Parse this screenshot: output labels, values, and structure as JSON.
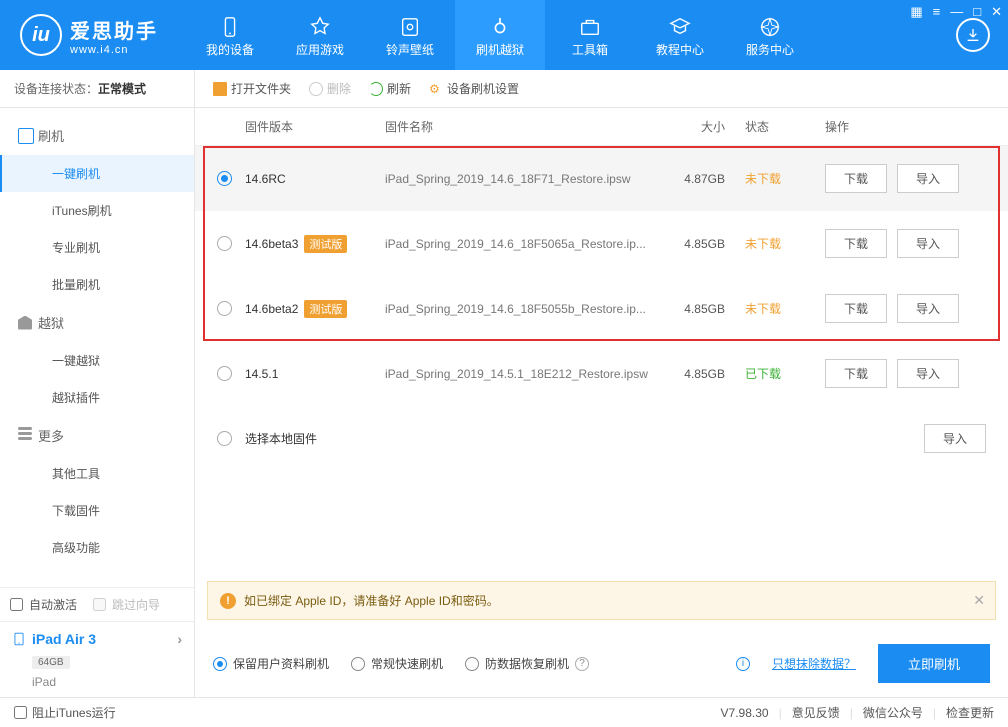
{
  "logo": {
    "title": "爱思助手",
    "sub": "www.i4.cn"
  },
  "nav": {
    "device": "我的设备",
    "apps": "应用游戏",
    "ringtone": "铃声壁纸",
    "flash": "刷机越狱",
    "toolbox": "工具箱",
    "tutorial": "教程中心",
    "service": "服务中心"
  },
  "status": {
    "label": "设备连接状态：",
    "value": "正常模式"
  },
  "sidebar": {
    "flash": "刷机",
    "one_click_flash": "一键刷机",
    "itunes_flash": "iTunes刷机",
    "pro_flash": "专业刷机",
    "batch_flash": "批量刷机",
    "jailbreak": "越狱",
    "one_click_jb": "一键越狱",
    "jb_plugins": "越狱插件",
    "more": "更多",
    "other_tools": "其他工具",
    "download_fw": "下载固件",
    "advanced": "高级功能"
  },
  "toolbar": {
    "open_folder": "打开文件夹",
    "delete": "删除",
    "refresh": "刷新",
    "settings": "设备刷机设置"
  },
  "table_head": {
    "version": "固件版本",
    "name": "固件名称",
    "size": "大小",
    "status": "状态",
    "action": "操作"
  },
  "rows": [
    {
      "version": "14.6RC",
      "tag": "",
      "name": "iPad_Spring_2019_14.6_18F71_Restore.ipsw",
      "size": "4.87GB",
      "status": "未下载",
      "status_class": "orange",
      "selected": true,
      "download": "下载",
      "import": "导入"
    },
    {
      "version": "14.6beta3",
      "tag": "测试版",
      "name": "iPad_Spring_2019_14.6_18F5065a_Restore.ip...",
      "size": "4.85GB",
      "status": "未下载",
      "status_class": "orange",
      "selected": false,
      "download": "下载",
      "import": "导入"
    },
    {
      "version": "14.6beta2",
      "tag": "测试版",
      "name": "iPad_Spring_2019_14.6_18F5055b_Restore.ip...",
      "size": "4.85GB",
      "status": "未下载",
      "status_class": "orange",
      "selected": false,
      "download": "下载",
      "import": "导入"
    },
    {
      "version": "14.5.1",
      "tag": "",
      "name": "iPad_Spring_2019_14.5.1_18E212_Restore.ipsw",
      "size": "4.85GB",
      "status": "已下载",
      "status_class": "green",
      "selected": false,
      "download": "下载",
      "import": "导入"
    }
  ],
  "local_fw": {
    "label": "选择本地固件",
    "import": "导入"
  },
  "auto_activate": "自动激活",
  "skip_guide": "跳过向导",
  "device": {
    "name": "iPad Air 3",
    "storage": "64GB",
    "type": "iPad"
  },
  "notice": "如已绑定 Apple ID，请准备好 Apple ID和密码。",
  "flash_opts": {
    "keep_data": "保留用户资料刷机",
    "normal": "常规快速刷机",
    "anti_recovery": "防数据恢复刷机",
    "erase_link": "只想抹除数据？",
    "flash_now": "立即刷机"
  },
  "footer": {
    "block_itunes": "阻止iTunes运行",
    "version": "V7.98.30",
    "feedback": "意见反馈",
    "wechat": "微信公众号",
    "check_update": "检查更新"
  }
}
